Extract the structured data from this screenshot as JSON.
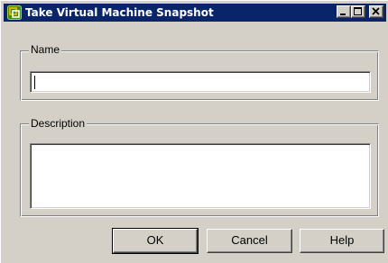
{
  "window": {
    "title": "Take Virtual Machine Snapshot"
  },
  "name_group": {
    "legend": "Name",
    "value": ""
  },
  "description_group": {
    "legend": "Description",
    "value": ""
  },
  "buttons": {
    "ok": "OK",
    "cancel": "Cancel",
    "help": "Help"
  },
  "colors": {
    "titlebar": "#0a246a",
    "face": "#d4d0c8",
    "icon_accent": "#f2c200"
  },
  "icons": {
    "app": "vm-snapshot-icon",
    "minimize": "minimize-icon",
    "maximize": "maximize-icon",
    "close": "close-icon"
  }
}
